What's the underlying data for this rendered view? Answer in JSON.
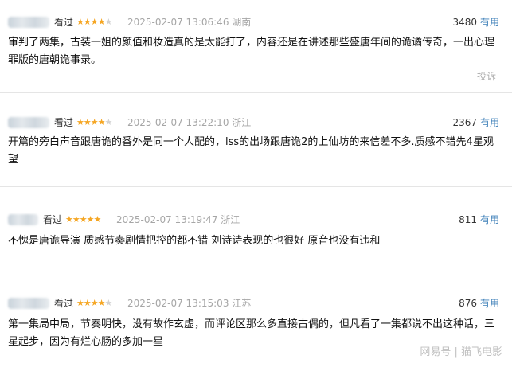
{
  "reviews": [
    {
      "seen_label": "看过",
      "rating": 4,
      "date": "2025-02-07 13:06:46",
      "location": "湖南",
      "votes": "3480",
      "useful_label": "有用",
      "text": "审判了两集，古装一姐的颜值和妆造真的是太能打了，内容还是在讲述那些盛唐年间的诡谲传奇，一出心理罪版的唐朝诡事录。",
      "report_label": "投诉"
    },
    {
      "seen_label": "看过",
      "rating": 4,
      "date": "2025-02-07 13:22:10",
      "location": "浙江",
      "votes": "2367",
      "useful_label": "有用",
      "text": "开篇的旁白声音跟唐诡的番外是同一个人配的，lss的出场跟唐诡2的上仙坊的来信差不多.质感不错先4星观望"
    },
    {
      "seen_label": "看过",
      "rating": 5,
      "date": "2025-02-07 13:19:47",
      "location": "浙江",
      "votes": "811",
      "useful_label": "有用",
      "text": "不愧是唐诡导演 质感节奏剧情把控的都不错 刘诗诗表现的也很好 原音也没有违和"
    },
    {
      "seen_label": "看过",
      "rating": 4,
      "date": "2025-02-07 13:15:03",
      "location": "江苏",
      "votes": "876",
      "useful_label": "有用",
      "text": "第一集局中局，节奏明快，没有故作玄虚，而评论区那么多直接古偶的，但凡看了一集都说不出这种话，三星起步，因为有烂心肠的多加一星"
    }
  ],
  "watermark": "网易号 | 猫飞电影"
}
